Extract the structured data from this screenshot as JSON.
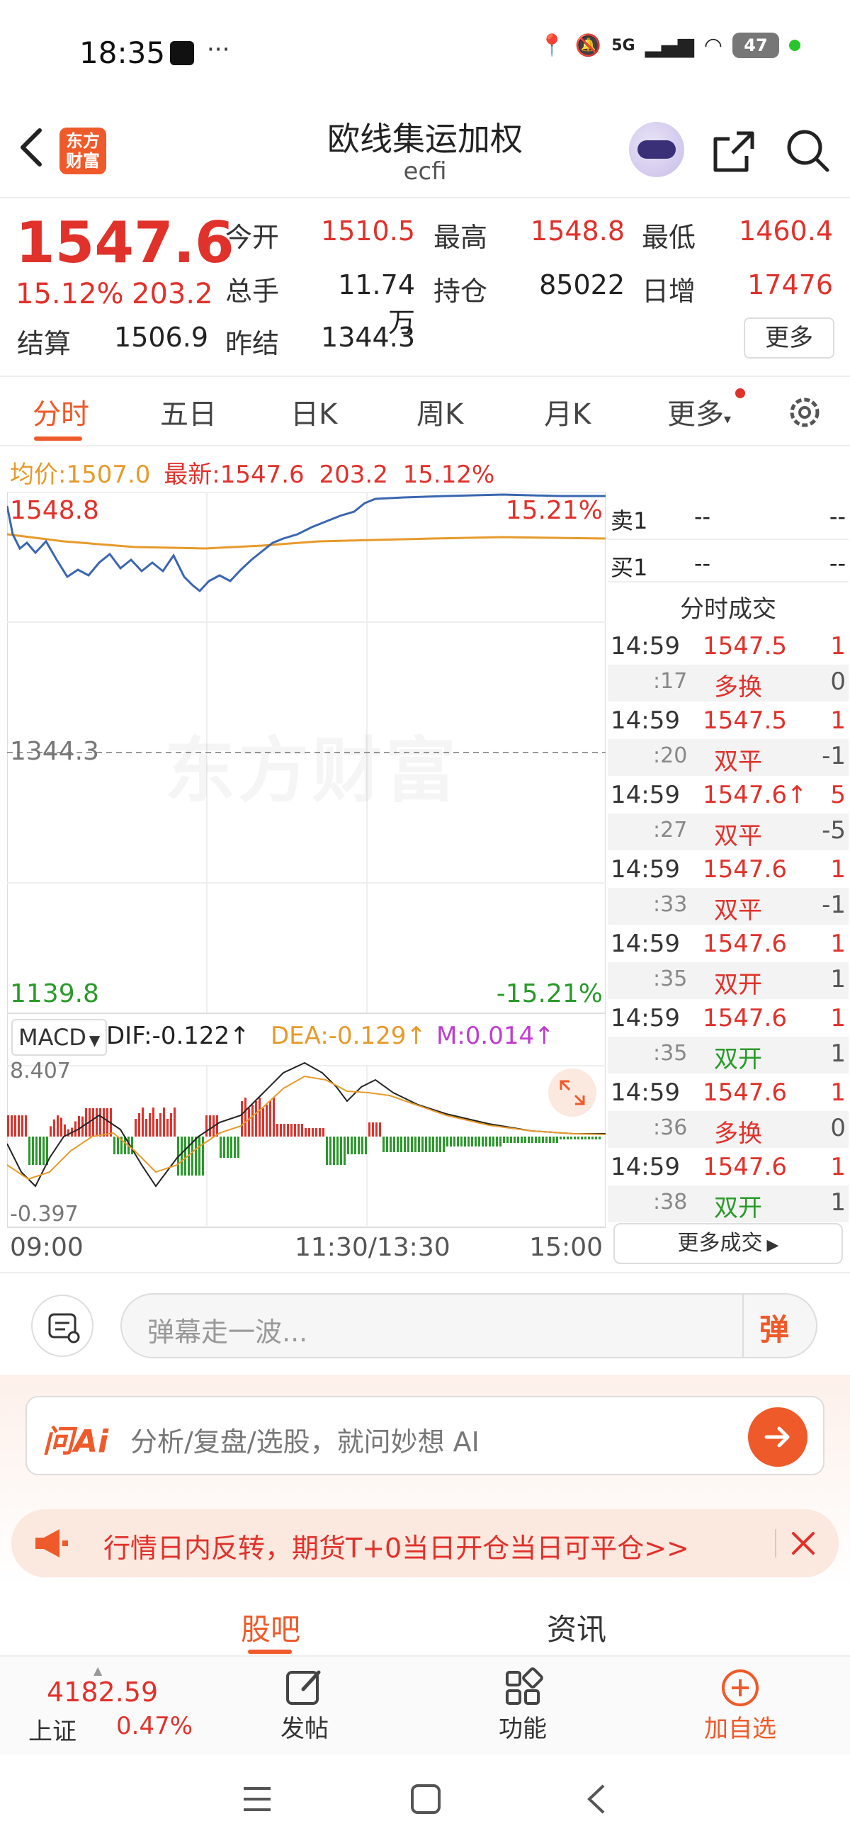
{
  "status": {
    "time": "18:35",
    "battery": "47",
    "network": "5G"
  },
  "header": {
    "title": "欧线集运加权",
    "code": "ecfi",
    "logo_line1": "东方",
    "logo_line2": "财富"
  },
  "quote": {
    "price": "1547.6",
    "change_pct": "15.12%",
    "change": "203.2",
    "open_label": "今开",
    "open": "1510.5",
    "high_label": "最高",
    "high": "1548.8",
    "low_label": "最低",
    "low": "1460.4",
    "volume_label": "总手",
    "volume": "11.74万",
    "position_label": "持仓",
    "position": "85022",
    "daily_inc_label": "日增",
    "daily_inc": "17476",
    "settle_label": "结算",
    "settle": "1506.9",
    "prev_settle_label": "昨结",
    "prev_settle": "1344.3",
    "more_label": "更多"
  },
  "tabs": [
    "分时",
    "五日",
    "日K",
    "周K",
    "月K",
    "更多"
  ],
  "summary": {
    "avg_label": "均价:",
    "avg": "1507.0",
    "latest_label": "最新:",
    "latest": "1547.6",
    "change": "203.2",
    "change_pct": "15.12%"
  },
  "chart": {
    "top_price": "1548.8",
    "top_pct": "15.21%",
    "mid_price": "1344.3",
    "bottom_price": "1139.8",
    "bottom_pct": "-15.21%",
    "watermark": "东方财富",
    "macd_label": "MACD",
    "dif": "DIF:-0.122↑",
    "dea": "DEA:-0.129↑",
    "m": "M:0.014↑",
    "macd_top": "8.407",
    "macd_bottom": "-0.397",
    "time_start": "09:00",
    "time_mid": "11:30/13:30",
    "time_end": "15:00"
  },
  "orderbook": {
    "sell_label": "卖1",
    "buy_label": "买1",
    "empty": "--",
    "title": "分时成交"
  },
  "trades": [
    {
      "t1": "14:59",
      "p": "1547.5",
      "v": "1",
      "t2": ":17",
      "type": "多换",
      "d": "0",
      "pc": "red",
      "tc": "red",
      "dc": "gray"
    },
    {
      "t1": "14:59",
      "p": "1547.5",
      "v": "1",
      "t2": ":20",
      "type": "双平",
      "d": "-1",
      "pc": "red",
      "tc": "red",
      "dc": "gray"
    },
    {
      "t1": "14:59",
      "p": "1547.6↑",
      "v": "5",
      "t2": ":27",
      "type": "双平",
      "d": "-5",
      "pc": "red",
      "tc": "red",
      "dc": "gray"
    },
    {
      "t1": "14:59",
      "p": "1547.6",
      "v": "1",
      "t2": ":33",
      "type": "双平",
      "d": "-1",
      "pc": "red",
      "tc": "red",
      "dc": "gray"
    },
    {
      "t1": "14:59",
      "p": "1547.6",
      "v": "1",
      "t2": ":35",
      "type": "双开",
      "d": "1",
      "pc": "red",
      "tc": "red",
      "dc": "gray"
    },
    {
      "t1": "14:59",
      "p": "1547.6",
      "v": "1",
      "t2": ":35",
      "type": "双开",
      "d": "1",
      "pc": "red",
      "tc": "green",
      "dc": "gray"
    },
    {
      "t1": "14:59",
      "p": "1547.6",
      "v": "1",
      "t2": ":36",
      "type": "多换",
      "d": "0",
      "pc": "red",
      "tc": "red",
      "dc": "gray"
    },
    {
      "t1": "14:59",
      "p": "1547.6",
      "v": "1",
      "t2": ":38",
      "type": "双开",
      "d": "1",
      "pc": "red",
      "tc": "green",
      "dc": "gray"
    }
  ],
  "more_trades": "更多成交",
  "comment": {
    "placeholder": "弹幕走一波...",
    "send": "弹"
  },
  "ai": {
    "brand": "问Ai",
    "placeholder": "分析/复盘/选股，就问妙想 AI"
  },
  "banner": {
    "text": "行情日内反转，期货T+0当日开仓当日可平仓>>"
  },
  "bottom_tabs": [
    "股吧",
    "资讯"
  ],
  "nav": {
    "index_value": "4182.59",
    "index_name": "上证",
    "index_change": "0.47%",
    "post": "发帖",
    "func": "功能",
    "add": "加自选"
  },
  "colors": {
    "up": "#e0312b",
    "down": "#2a9a2a",
    "accent": "#ef5a2a",
    "avg": "#e79a2a",
    "price_line": "#3a66b0"
  }
}
